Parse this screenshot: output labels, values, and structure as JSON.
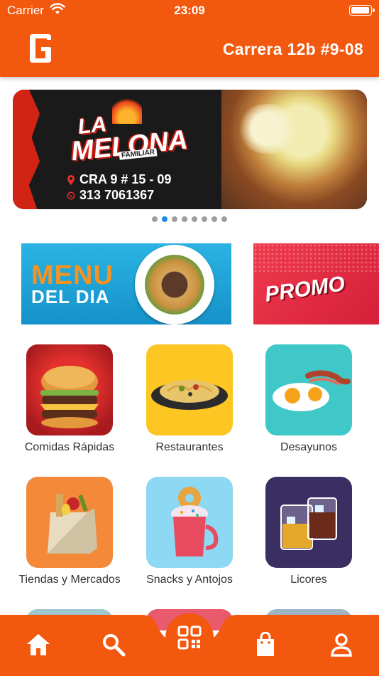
{
  "status_bar": {
    "carrier": "Carrier",
    "time": "23:09"
  },
  "header": {
    "address": "Carrera 12b #9-08"
  },
  "banner": {
    "brand_line1": "LA",
    "brand_line2": "MELONA",
    "brand_tag": "FAMILIAR",
    "address": "CRA 9 # 15 - 09",
    "phone": "313 7061367"
  },
  "carousel": {
    "total": 8,
    "active": 1
  },
  "promos": {
    "menu_word1": "MENU",
    "menu_word2": "DEL DIA",
    "promo_text": "PROMO"
  },
  "categories": [
    {
      "label": "Comidas Rápidas",
      "icon": "burger-icon"
    },
    {
      "label": "Restaurantes",
      "icon": "pasta-plate-icon"
    },
    {
      "label": "Desayunos",
      "icon": "breakfast-icon"
    },
    {
      "label": "Tiendas y Mercados",
      "icon": "grocery-bag-icon"
    },
    {
      "label": "Snacks y Antojos",
      "icon": "milkshake-icon"
    },
    {
      "label": "Licores",
      "icon": "liquor-glasses-icon"
    }
  ],
  "bottom_nav": [
    "home-icon",
    "search-icon",
    "categories-grid-icon",
    "shopping-bag-icon",
    "profile-icon"
  ],
  "colors": {
    "brand": "#F2580E",
    "dot_active": "#1e88e5",
    "dot_inactive": "#9e9e9e"
  }
}
